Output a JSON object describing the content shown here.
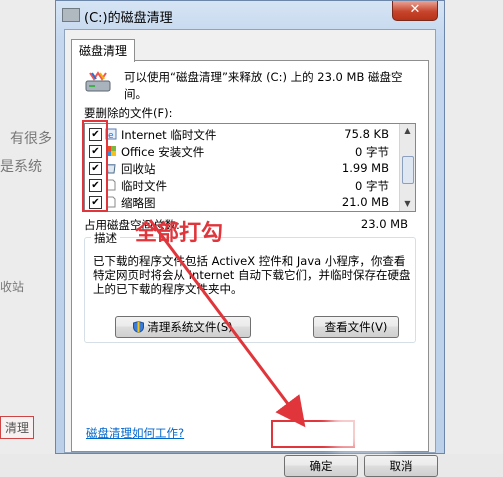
{
  "background": {
    "texts": [
      "有很多",
      "是系统",
      "收站",
      "清理"
    ]
  },
  "window": {
    "title": "(C:)的磁盘清理",
    "close_glyph": "✕",
    "tab_label": "磁盘清理",
    "intro_text": "可以使用“磁盘清理”来释放 (C:) 上的 23.0 MB 磁盘空间。",
    "files_label": "要删除的文件(F):",
    "files": [
      {
        "name": "Internet 临时文件",
        "size": "75.8 KB",
        "checked": true,
        "icon": "ie-icon"
      },
      {
        "name": "Office 安装文件",
        "size": "0 字节",
        "checked": true,
        "icon": "office-icon"
      },
      {
        "name": "回收站",
        "size": "1.99 MB",
        "checked": true,
        "icon": "recycle-bin-icon"
      },
      {
        "name": "临时文件",
        "size": "0 字节",
        "checked": true,
        "icon": "file-icon"
      },
      {
        "name": "缩略图",
        "size": "21.0 MB",
        "checked": true,
        "icon": "file-icon"
      }
    ],
    "total_label": "占用磁盘空间总数:",
    "total_value": "23.0 MB",
    "description_title": "描述",
    "description_text": "已下载的程序文件包括 ActiveX 控件和 Java 小程序，你查看特定网页时将会从 Internet 自动下载它们，并临时保存在硬盘上的已下载的程序文件夹中。",
    "clean_system_button": "清理系统文件(S)",
    "view_files_button": "查看文件(V)",
    "help_link": "磁盘清理如何工作?",
    "ok_button": "确定",
    "cancel_button": "取消"
  },
  "annotation": {
    "text": "全部打勾",
    "color": "#e0353b"
  }
}
